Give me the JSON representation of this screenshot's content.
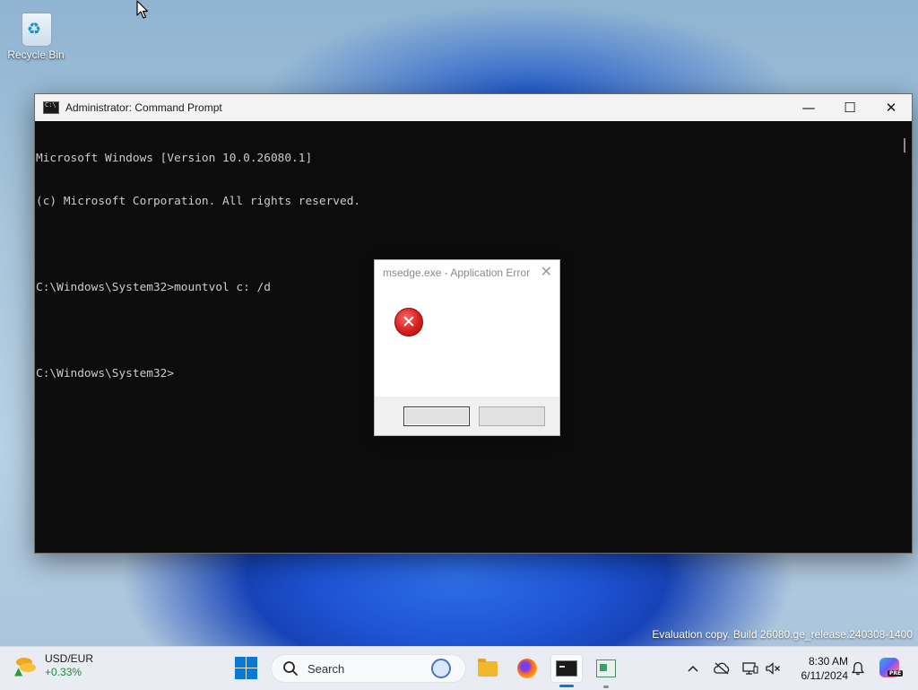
{
  "desktop": {
    "recycle_bin_label": "Recycle Bin",
    "watermark": "Evaluation copy. Build 26080.ge_release.240308-1400"
  },
  "cmd_window": {
    "title": "Administrator: Command Prompt",
    "controls": {
      "minimize": "—",
      "maximize": "☐",
      "close": "✕"
    },
    "lines": [
      "Microsoft Windows [Version 10.0.26080.1]",
      "(c) Microsoft Corporation. All rights reserved.",
      "",
      "C:\\Windows\\System32>mountvol c: /d",
      "",
      "C:\\Windows\\System32>"
    ]
  },
  "error_dialog": {
    "title": "msedge.exe - Application Error",
    "close_glyph": "✕",
    "icon_glyph": "✕",
    "button1_label": "",
    "button2_label": ""
  },
  "taskbar": {
    "widget": {
      "pair": "USD/EUR",
      "change": "+0.33%",
      "change_color": "#1e8a3a"
    },
    "search_placeholder": "Search",
    "apps": [
      "file-explorer",
      "firefox",
      "command-prompt",
      "other-app"
    ],
    "tray": {
      "chevron": "^",
      "bell": "🔔"
    },
    "clock": {
      "time": "8:30 AM",
      "date": "6/11/2024"
    },
    "copilot_badge": "PRE"
  },
  "colors": {
    "accent": "#0a78d4",
    "error_red": "#d81f1f",
    "console_bg": "#0c0c0c",
    "console_fg": "#cccccc"
  }
}
